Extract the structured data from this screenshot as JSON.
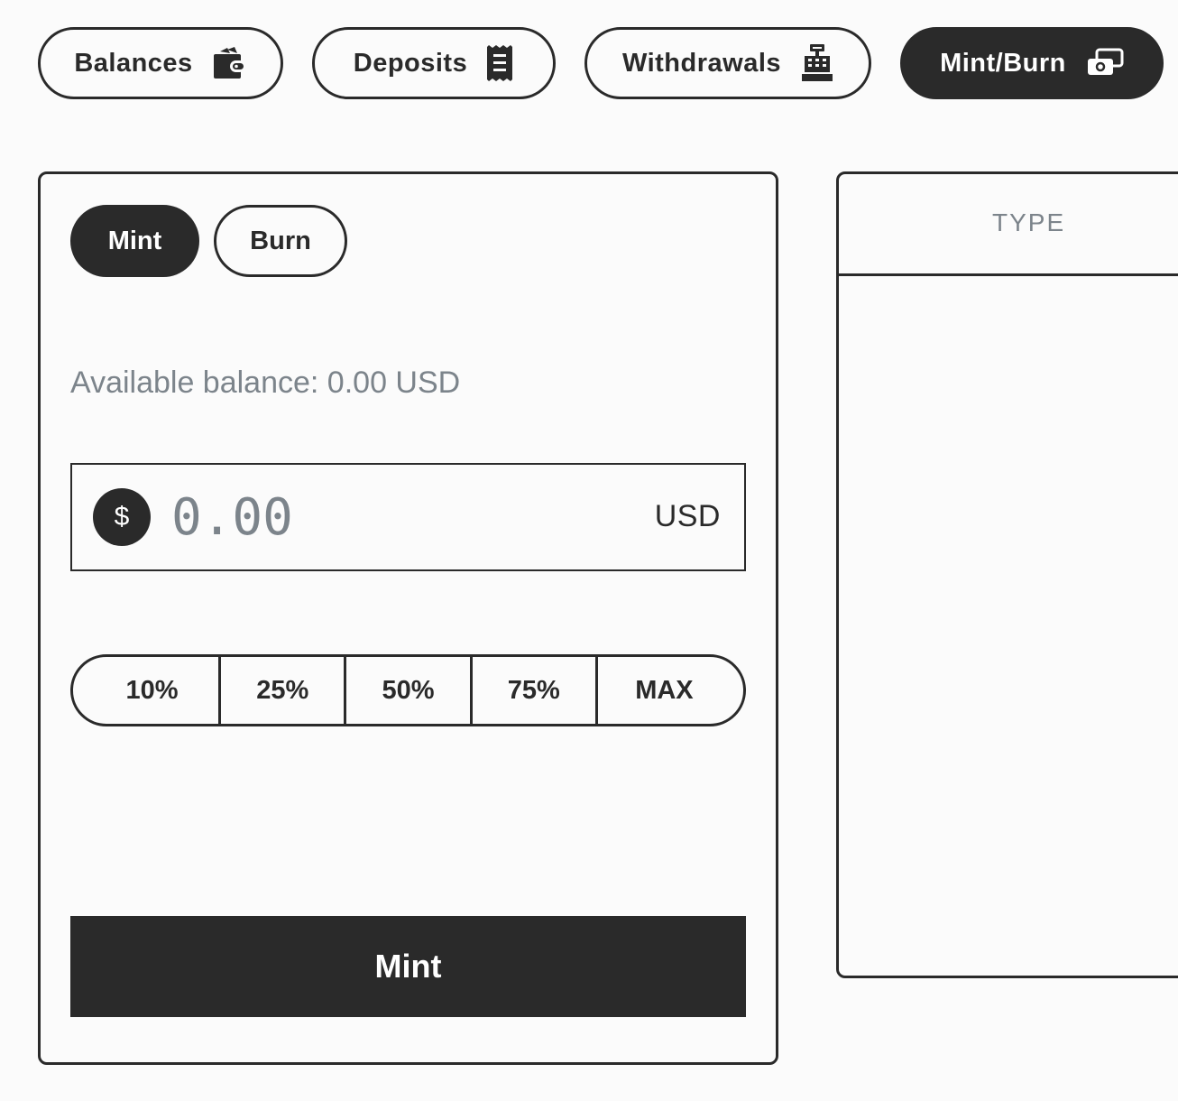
{
  "tabs": [
    {
      "label": "Balances",
      "icon": "wallet-icon",
      "active": false
    },
    {
      "label": "Deposits",
      "icon": "receipt-icon",
      "active": false
    },
    {
      "label": "Withdrawals",
      "icon": "cash-register-icon",
      "active": false
    },
    {
      "label": "Mint/Burn",
      "icon": "money-bills-icon",
      "active": true
    }
  ],
  "form": {
    "toggle": {
      "mint": "Mint",
      "burn": "Burn",
      "selected": "Mint"
    },
    "available_balance": "Available balance: 0.00 USD",
    "amount": {
      "currency_symbol": "$",
      "placeholder": "0.00",
      "value": "",
      "currency": "USD"
    },
    "percent_options": [
      "10%",
      "25%",
      "50%",
      "75%",
      "MAX"
    ],
    "submit_label": "Mint"
  },
  "history_table": {
    "columns": [
      "TYPE"
    ],
    "rows": []
  },
  "colors": {
    "primary": "#2a2a2a",
    "muted_text": "#7c848b",
    "background": "#fbfbfb"
  }
}
